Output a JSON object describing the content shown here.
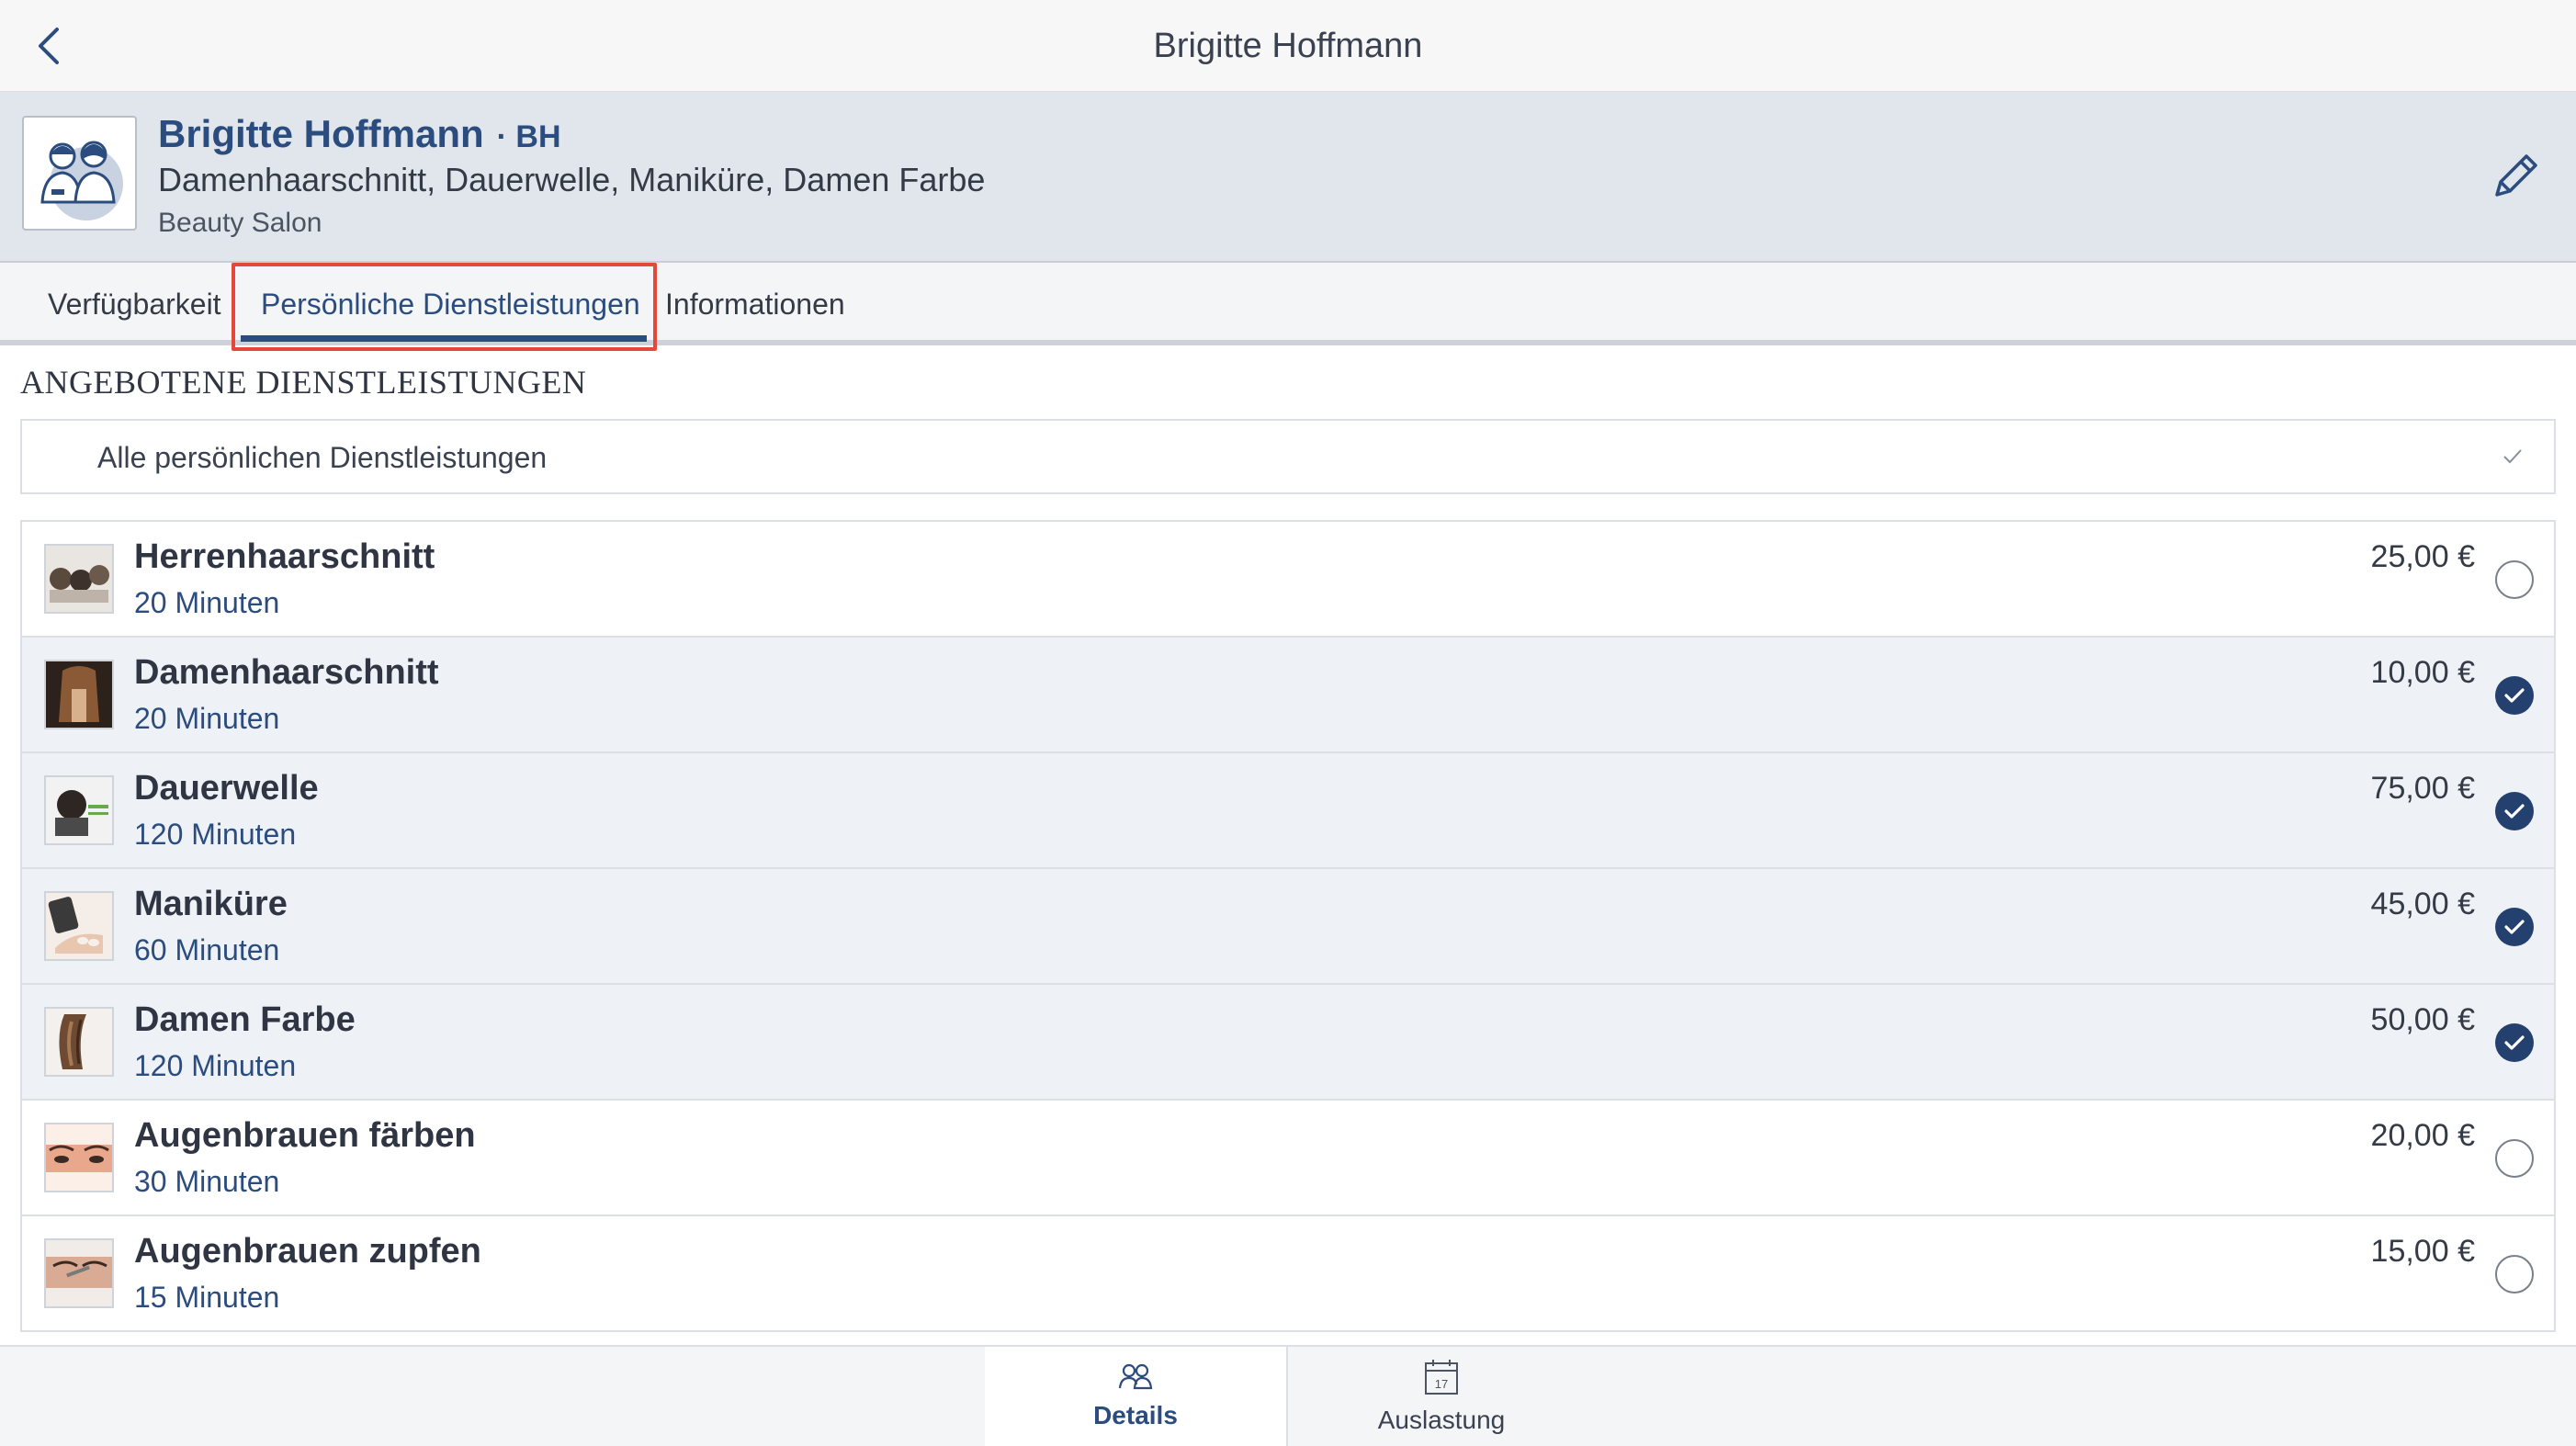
{
  "nav": {
    "title": "Brigitte Hoffmann",
    "back_icon": "chevron-left-icon"
  },
  "profile": {
    "name": "Brigitte Hoffmann",
    "initials": "· BH",
    "services": "Damenhaarschnitt, Dauerwelle, Maniküre, Damen Farbe",
    "salon": "Beauty Salon",
    "edit_icon": "pencil-icon"
  },
  "tabs": [
    {
      "label": "Verfügbarkeit",
      "active": false
    },
    {
      "label": "Persönliche Dienstleistungen",
      "active": true
    },
    {
      "label": "Informationen",
      "active": false
    }
  ],
  "section_title": "ANGEBOTENE DIENSTLEISTUNGEN",
  "filter": {
    "label": "Alle persönlichen Dienstleistungen",
    "icon": "checkmark-icon"
  },
  "services": [
    {
      "name": "Herrenhaarschnitt",
      "duration": "20 Minuten",
      "price": "25,00 €",
      "selected": false
    },
    {
      "name": "Damenhaarschnitt",
      "duration": "20 Minuten",
      "price": "10,00 €",
      "selected": true
    },
    {
      "name": "Dauerwelle",
      "duration": "120 Minuten",
      "price": "75,00 €",
      "selected": true
    },
    {
      "name": "Maniküre",
      "duration": "60 Minuten",
      "price": "45,00 €",
      "selected": true
    },
    {
      "name": "Damen Farbe",
      "duration": "120 Minuten",
      "price": "50,00 €",
      "selected": true
    },
    {
      "name": "Augenbrauen färben",
      "duration": "30 Minuten",
      "price": "20,00 €",
      "selected": false
    },
    {
      "name": "Augenbrauen zupfen",
      "duration": "15 Minuten",
      "price": "15,00 €",
      "selected": false
    }
  ],
  "bottom_tabs": [
    {
      "label": "Details",
      "icon": "people-icon",
      "active": true
    },
    {
      "label": "Auslastung",
      "icon": "calendar-icon",
      "calendar_day": "17",
      "active": false
    }
  ],
  "colors": {
    "accent": "#2b4c7e",
    "selected_row": "#eef1f6",
    "highlight": "#e5473a"
  }
}
